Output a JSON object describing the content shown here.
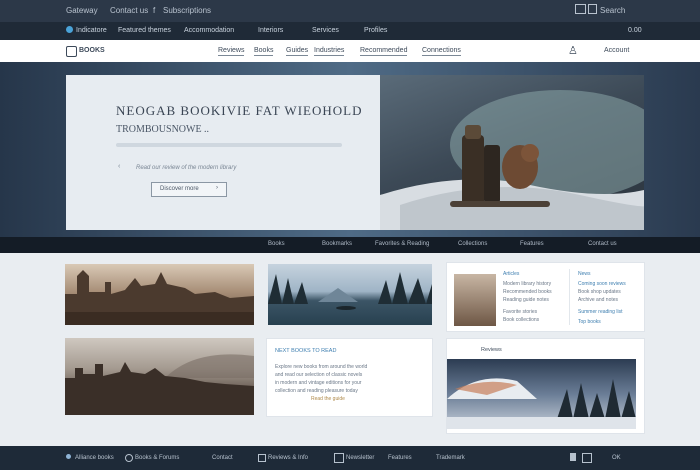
{
  "topbar": {
    "left": [
      "Gateway",
      "Contact us",
      "f",
      "Subscriptions"
    ],
    "right": "Search"
  },
  "navbar": {
    "items": [
      "Indicatore",
      "Featured themes",
      "Accommodation",
      "Interiors",
      "Services",
      "Profiles"
    ],
    "right": "0.00"
  },
  "menubar": {
    "brand": "BOOKS",
    "items": [
      "Reviews",
      "Books",
      "Guides",
      "Industries",
      "Recommended",
      "Connections"
    ],
    "right": "Account"
  },
  "hero": {
    "title": "NEOGAB BOOKIVIE FAT WIEOHOLD",
    "subtitle": "TROMBOUSNOWE ..",
    "caption": "Read our review of the modern library",
    "cta": "Discover more",
    "cta_arrow": "›"
  },
  "strip": {
    "items": [
      "Books",
      "Bookmarks",
      "Favorites & Reading",
      "Collections",
      "Features",
      "Contact us"
    ]
  },
  "cards": {
    "c3": {
      "header": "Articles",
      "lines": [
        "Modern library history",
        "Recommended books",
        "Reading guide notes",
        "Favorite stories",
        "Book collections"
      ],
      "side_header": "News",
      "side_lines": [
        "Coming soon reviews",
        "Book shop updates",
        "Archive and notes",
        "Summer reading list",
        "Top books"
      ]
    },
    "c5": {
      "header": "NEXT BOOKS TO READ",
      "lines": [
        "Explore new books from around the world",
        "and read our selection of classic novels",
        "in modern and vintage editions for your",
        "collection and reading pleasure today"
      ],
      "link": "Read the guide"
    },
    "c6": {
      "label": "Reviews"
    }
  },
  "footer": {
    "items": [
      "Alliance books",
      "Books & Forums",
      "Contact",
      "Reviews & Info",
      "Newsletter",
      "Features",
      "Trademark"
    ],
    "right": "OK"
  },
  "colors": {
    "topbar": "#2c3848",
    "navbar": "#1f2a37",
    "accent": "#3f7fb0",
    "strip": "#141c26",
    "footer": "#1e2a38"
  }
}
